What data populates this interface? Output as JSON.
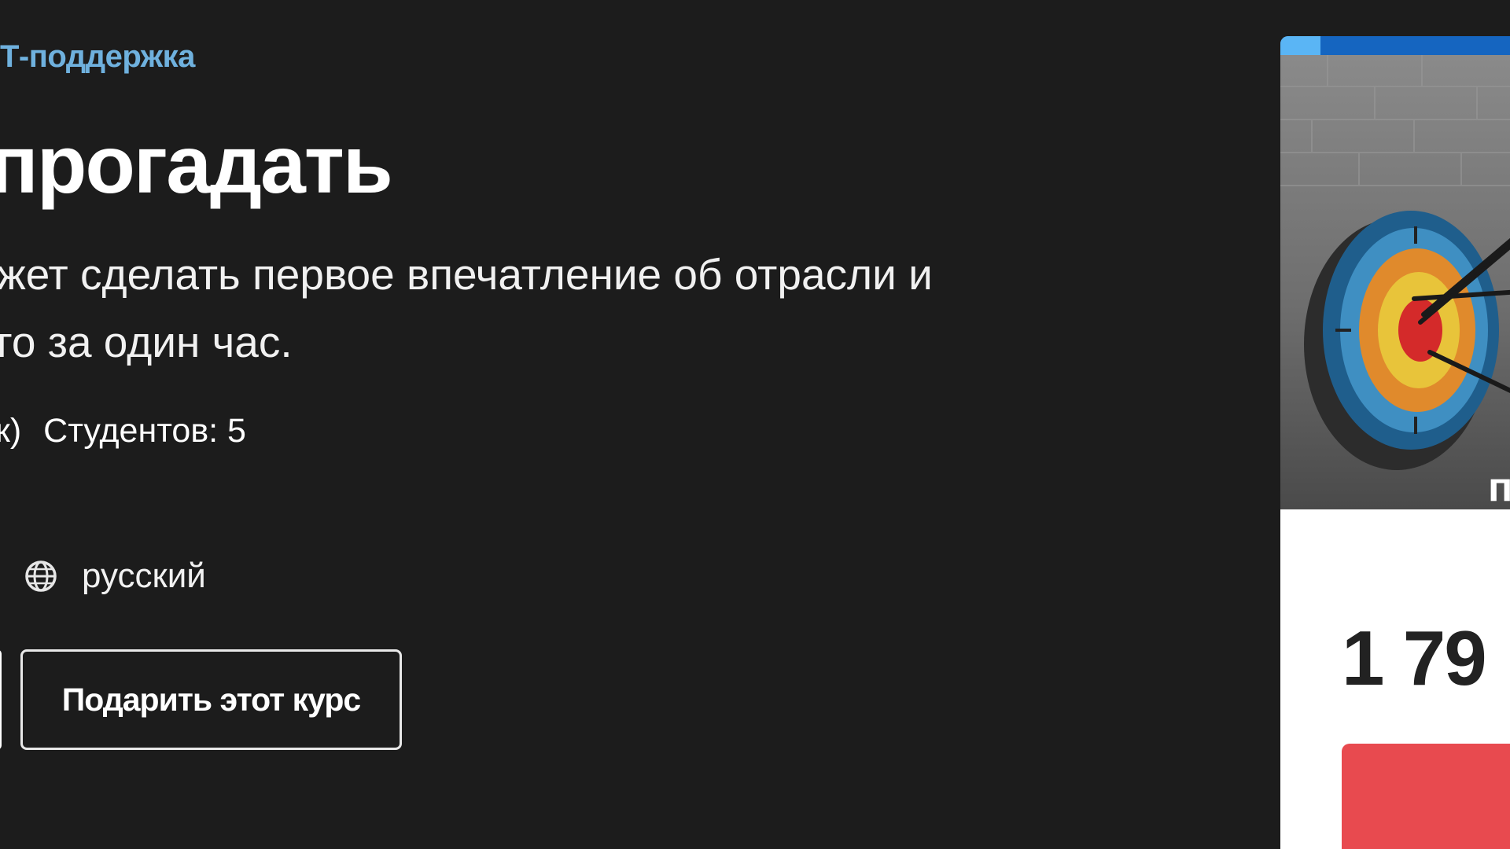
{
  "breadcrumb": {
    "label": "Т-поддержка"
  },
  "course": {
    "title": "прогадать",
    "subtitle_lines": [
      "жет сделать первое впечатление об отрасли и",
      "го за один час."
    ],
    "ratings_tail": "к)",
    "students": "Студентов: 5",
    "language": "русский",
    "gift_button_label": "Подарить этот курс"
  },
  "card": {
    "preview_label": "п",
    "price": "1 79",
    "progress_fraction": 0.16
  },
  "colors": {
    "background": "#1c1c1c",
    "breadcrumb": "#6fb1de",
    "buy_button": "#e84a4f",
    "progress_track": "#1565c0",
    "progress_fill": "#5ab5f5",
    "target_outer": "#1f5e8c",
    "target_orange": "#e08a2c",
    "target_yellow": "#e8c43a",
    "target_center": "#d42a2a"
  },
  "icons": {
    "language": "globe-icon",
    "preview": "archery-target-icon"
  }
}
